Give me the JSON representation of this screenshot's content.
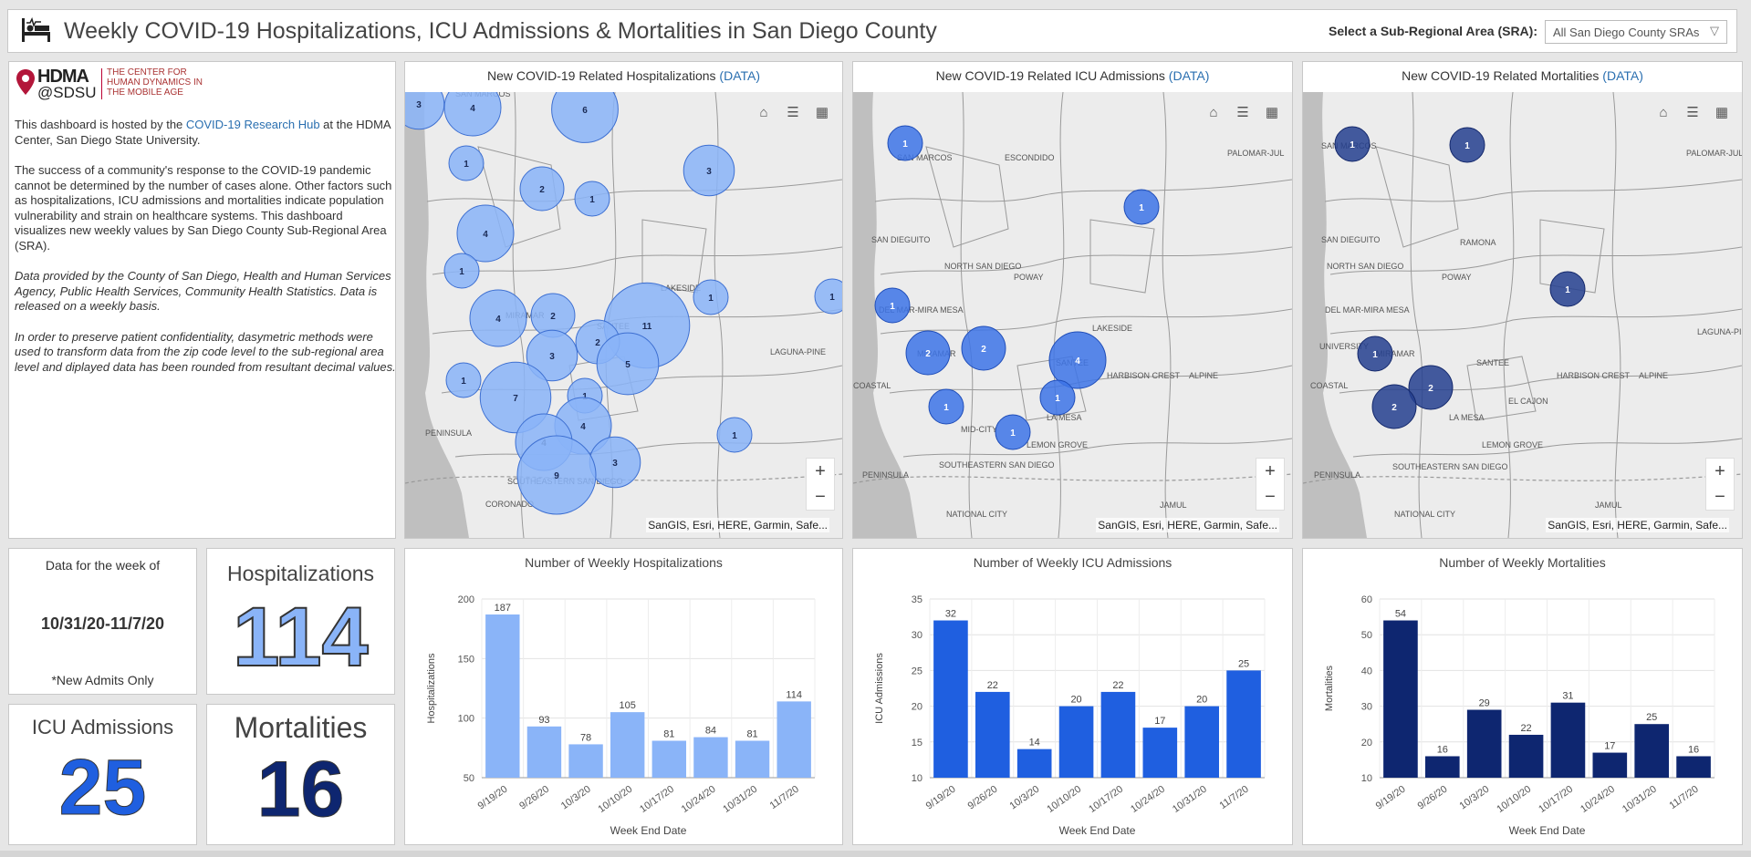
{
  "header": {
    "title": "Weekly COVID-19 Hospitalizations, ICU Admissions & Mortalities in San Diego County",
    "sra_label": "Select a Sub-Regional Area (SRA):",
    "sra_value": "All San Diego County SRAs"
  },
  "info": {
    "logo_name": "HDMA",
    "logo_sdsu": "@SDSU",
    "logo_center": "THE CENTER FOR HUMAN DYNAMICS IN THE MOBILE AGE",
    "p1_pre": "This dashboard is hosted by the ",
    "p1_link": "COVID-19 Research Hub",
    "p1_post": " at the HDMA Center, San Diego State University.",
    "p2": "The success of a community's response to the COVID-19 pandemic cannot be determined by the number of cases alone. Other factors such as hospitalizations, ICU admissions and mortalities indicate population vulnerability and strain on healthcare systems. This dashboard visualizes new weekly values by San Diego County Sub-Regional Area (SRA).",
    "p3": "Data provided by the County of San Diego, Health and Human Services Agency, Public Health Services, Community Health Statistics. Data is released on a weekly basis.",
    "p4": "In order to preserve patient confidentiality, dasymetric methods were used to transform data from the zip code level to the sub-regional area level and diplayed data has been rounded from resultant decimal values."
  },
  "maps": [
    {
      "title": "New COVID-19 Related Hospitalizations",
      "data_link": "(DATA)",
      "color": "#8ab4f8",
      "stroke": "#3d6fd1",
      "labels": [
        "SAN MARCOS",
        "MIRAMAR",
        "SANTEE",
        "LAKESIDE",
        "LAGUNA-PINE",
        "PENINSULA",
        "SOUTHEASTERN SAN DIEGO",
        "CORONADO"
      ],
      "bubbles": [
        3,
        4,
        6,
        1,
        3,
        2,
        1,
        4,
        1,
        1,
        1,
        4,
        2,
        11,
        2,
        3,
        1,
        5,
        7,
        1,
        4,
        4,
        3,
        1,
        9
      ]
    },
    {
      "title": "New COVID-19 Related ICU Admissions",
      "data_link": "(DATA)",
      "color": "#3d74e8",
      "stroke": "#1f4db8",
      "labels": [
        "SAN MARCOS",
        "ESCONDIDO",
        "PALOMAR-JUL",
        "SAN DIEGUITO",
        "NORTH SAN DIEGO",
        "POWAY",
        "DEL MAR-MIRA MESA",
        "LAKESIDE",
        "MIRAMAR",
        "SANTEE",
        "COASTAL",
        "HARBISON CREST",
        "ALPINE",
        "LA MESA",
        "MID-CITY",
        "LEMON GROVE",
        "PENINSULA",
        "SOUTHEASTERN SAN DIEGO",
        "NATIONAL CITY",
        "JAMUL"
      ],
      "bubbles": [
        1,
        1,
        1,
        2,
        2,
        4,
        1,
        1,
        1
      ]
    },
    {
      "title": "New COVID-19 Related Mortalities",
      "data_link": "(DATA)",
      "color": "#243f8f",
      "stroke": "#14286b",
      "labels": [
        "SAN MARCOS",
        "PALOMAR-JUL",
        "SAN DIEGUITO",
        "RAMONA",
        "NORTH SAN DIEGO",
        "POWAY",
        "DEL MAR-MIRA MESA",
        "LAGUNA-PI",
        "UNIVERSITY",
        "MIRAMAR",
        "SANTEE",
        "COASTAL",
        "HARBISON CREST",
        "ALPINE",
        "EL CAJON",
        "LA MESA",
        "PENINSULA",
        "LEMON GROVE",
        "SOUTHEASTERN SAN DIEGO",
        "NATIONAL CITY",
        "JAMUL"
      ],
      "bubbles": [
        1,
        1,
        1,
        1,
        2,
        2
      ]
    }
  ],
  "map_attribution": "SanGIS, Esri, HERE, Garmin, Safe...",
  "week": {
    "label": "Data for the week of",
    "range": "10/31/20-11/7/20",
    "note": "*New Admits Only"
  },
  "kpis": {
    "hosp_label": "Hospitalizations",
    "hosp_value": "114",
    "icu_label": "ICU Admissions",
    "icu_value": "25",
    "mort_label": "Mortalities",
    "mort_value": "16"
  },
  "chart_data": [
    {
      "type": "bar",
      "title": "Number of Weekly Hospitalizations",
      "xlabel": "Week End Date",
      "ylabel": "Hospitalizations",
      "categories": [
        "9/19/20",
        "9/26/20",
        "10/3/20",
        "10/10/20",
        "10/17/20",
        "10/24/20",
        "10/31/20",
        "11/7/20"
      ],
      "values": [
        187,
        93,
        78,
        105,
        81,
        84,
        81,
        114
      ],
      "ylim": [
        50,
        200
      ],
      "yticks": [
        50,
        100,
        150,
        200
      ],
      "grid": true,
      "color": "#8ab4f8"
    },
    {
      "type": "bar",
      "title": "Number of Weekly ICU Admissions",
      "xlabel": "Week End Date",
      "ylabel": "ICU Admissions",
      "categories": [
        "9/19/20",
        "9/26/20",
        "10/3/20",
        "10/10/20",
        "10/17/20",
        "10/24/20",
        "10/31/20",
        "11/7/20"
      ],
      "values": [
        32,
        22,
        14,
        20,
        22,
        17,
        20,
        25
      ],
      "ylim": [
        10,
        35
      ],
      "yticks": [
        10,
        15,
        20,
        25,
        30,
        35
      ],
      "grid": true,
      "color": "#1f5fe0"
    },
    {
      "type": "bar",
      "title": "Number of Weekly Mortalities",
      "xlabel": "Week End Date",
      "ylabel": "Mortalities",
      "categories": [
        "9/19/20",
        "9/26/20",
        "10/3/20",
        "10/10/20",
        "10/17/20",
        "10/24/20",
        "10/31/20",
        "11/7/20"
      ],
      "values": [
        54,
        16,
        29,
        22,
        31,
        17,
        25,
        16
      ],
      "ylim": [
        10,
        60
      ],
      "yticks": [
        10,
        20,
        30,
        40,
        50,
        60
      ],
      "grid": true,
      "color": "#0e2670"
    }
  ]
}
